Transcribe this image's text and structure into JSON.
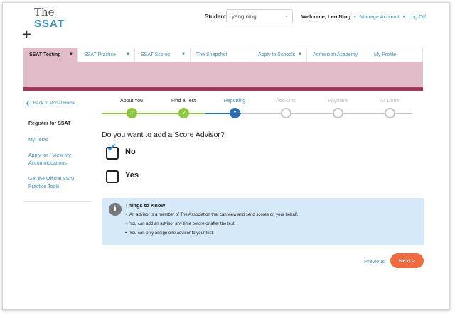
{
  "logo": {
    "line1": "The",
    "line2": "SSAT",
    "plus": "+"
  },
  "header": {
    "student_label": "Student:",
    "student_value": "yang ning",
    "welcome": "Welcome, Leo Ning",
    "manage_account": "Manage Account",
    "log_off": "Log Off"
  },
  "nav": {
    "items": [
      {
        "label": "SSAT Testing"
      },
      {
        "label": "SSAT Practice"
      },
      {
        "label": "SSAT Scores"
      },
      {
        "label": "The Snapshot"
      },
      {
        "label": "Apply to Schools"
      },
      {
        "label": "Admission Academy"
      },
      {
        "label": "My Profile"
      }
    ]
  },
  "sidebar": {
    "back": "Back to Portal Home",
    "heading": "Register for SSAT",
    "links": [
      "My Tests",
      "Apply for / View My Accommodations",
      "Get the Official SSAT Practice Tools"
    ]
  },
  "steps": [
    {
      "label": "About You",
      "state": "done"
    },
    {
      "label": "Find a Test",
      "state": "done"
    },
    {
      "label": "Reporting",
      "state": "current"
    },
    {
      "label": "Add-Ons",
      "state": "todo"
    },
    {
      "label": "Payment",
      "state": "todo"
    },
    {
      "label": "All Done",
      "state": "todo"
    }
  ],
  "question": "Do you want to add a Score Advisor?",
  "options": [
    {
      "label": "No",
      "checked": true
    },
    {
      "label": "Yes",
      "checked": false
    }
  ],
  "info": {
    "title": "Things to Know:",
    "items": [
      "An advisor is a member of The Association that can view and send scores on your behalf.",
      "You can add an advisor any time before or after the test.",
      "You can only assign one advisor to your test."
    ]
  },
  "footer": {
    "previous": "Previous",
    "next": "Next >"
  },
  "colors": {
    "accent": "#3d8fb5",
    "nav_active": "#e1bcc8",
    "banner_bar": "#9e3a5c",
    "step_done": "#8dc63f",
    "step_current": "#2b6cb5",
    "info_bg": "#d6e9f8",
    "next_button": "#ef6a3f"
  },
  "icons": {
    "back": "chevron-left-icon",
    "info": "info-icon",
    "check": "checkmark-icon",
    "dropdown": "chevron-down-icon",
    "step_done": "checkmark-icon",
    "step_current": "chevron-down-icon"
  }
}
